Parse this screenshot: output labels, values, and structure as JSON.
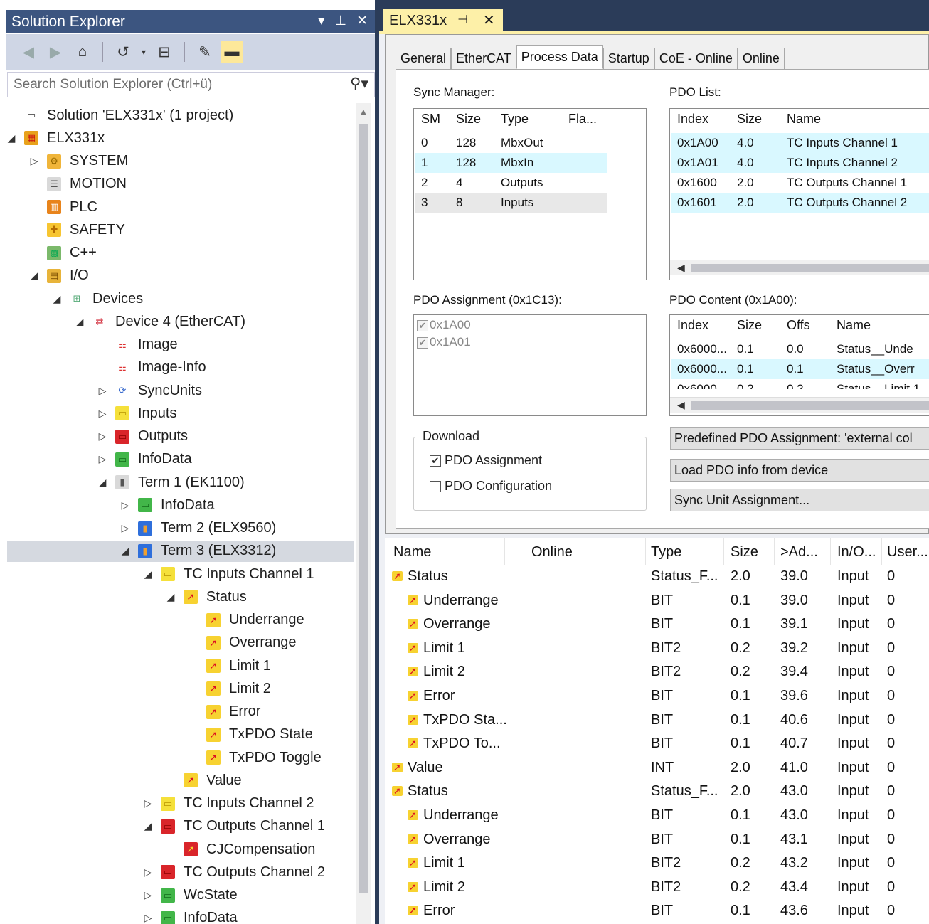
{
  "solution_explorer": {
    "title": "Solution Explorer",
    "title_controls": [
      "▾",
      "⊥",
      "✕"
    ],
    "search_placeholder": "Search Solution Explorer (Ctrl+ü)",
    "tree": [
      {
        "label": "Solution 'ELX331x' (1 project)",
        "indent": 0,
        "expander": "",
        "icon": "solution-icon"
      },
      {
        "label": "ELX331x",
        "indent": 0,
        "expander": "◢",
        "icon": "project-icon"
      },
      {
        "label": "SYSTEM",
        "indent": 1,
        "expander": "▷",
        "icon": "system-icon"
      },
      {
        "label": "MOTION",
        "indent": 1,
        "expander": "",
        "icon": "motion-icon"
      },
      {
        "label": "PLC",
        "indent": 1,
        "expander": "",
        "icon": "plc-icon"
      },
      {
        "label": "SAFETY",
        "indent": 1,
        "expander": "",
        "icon": "safety-icon"
      },
      {
        "label": "C++",
        "indent": 1,
        "expander": "",
        "icon": "cpp-icon"
      },
      {
        "label": "I/O",
        "indent": 1,
        "expander": "◢",
        "icon": "io-icon"
      },
      {
        "label": "Devices",
        "indent": 2,
        "expander": "◢",
        "icon": "devices-icon"
      },
      {
        "label": "Device 4 (EtherCAT)",
        "indent": 3,
        "expander": "◢",
        "icon": "ethercat-device-icon"
      },
      {
        "label": "Image",
        "indent": 4,
        "expander": "",
        "icon": "image-icon"
      },
      {
        "label": "Image-Info",
        "indent": 4,
        "expander": "",
        "icon": "image-info-icon"
      },
      {
        "label": "SyncUnits",
        "indent": 4,
        "expander": "▷",
        "icon": "syncunits-icon"
      },
      {
        "label": "Inputs",
        "indent": 4,
        "expander": "▷",
        "icon": "inputs-icon"
      },
      {
        "label": "Outputs",
        "indent": 4,
        "expander": "▷",
        "icon": "outputs-icon"
      },
      {
        "label": "InfoData",
        "indent": 4,
        "expander": "▷",
        "icon": "infodata-icon"
      },
      {
        "label": "Term 1 (EK1100)",
        "indent": 4,
        "expander": "◢",
        "icon": "terminal-icon"
      },
      {
        "label": "InfoData",
        "indent": 5,
        "expander": "▷",
        "icon": "infodata-icon"
      },
      {
        "label": "Term 2 (ELX9560)",
        "indent": 5,
        "expander": "▷",
        "icon": "terminal-blue-icon"
      },
      {
        "label": "Term 3 (ELX3312)",
        "indent": 5,
        "expander": "◢",
        "icon": "terminal-blue-icon",
        "selected": true
      },
      {
        "label": "TC Inputs Channel 1",
        "indent": 6,
        "expander": "◢",
        "icon": "inputs-icon"
      },
      {
        "label": "Status",
        "indent": 7,
        "expander": "◢",
        "icon": "variable-icon"
      },
      {
        "label": "Underrange",
        "indent": 8,
        "expander": "",
        "icon": "variable-icon"
      },
      {
        "label": "Overrange",
        "indent": 8,
        "expander": "",
        "icon": "variable-icon"
      },
      {
        "label": "Limit 1",
        "indent": 8,
        "expander": "",
        "icon": "variable-icon"
      },
      {
        "label": "Limit 2",
        "indent": 8,
        "expander": "",
        "icon": "variable-icon"
      },
      {
        "label": "Error",
        "indent": 8,
        "expander": "",
        "icon": "variable-icon"
      },
      {
        "label": "TxPDO State",
        "indent": 8,
        "expander": "",
        "icon": "variable-icon"
      },
      {
        "label": "TxPDO Toggle",
        "indent": 8,
        "expander": "",
        "icon": "variable-icon"
      },
      {
        "label": "Value",
        "indent": 7,
        "expander": "",
        "icon": "variable-icon"
      },
      {
        "label": "TC Inputs Channel 2",
        "indent": 6,
        "expander": "▷",
        "icon": "inputs-icon"
      },
      {
        "label": "TC Outputs Channel 1",
        "indent": 6,
        "expander": "◢",
        "icon": "outputs-icon"
      },
      {
        "label": "CJCompensation",
        "indent": 7,
        "expander": "",
        "icon": "output-variable-icon"
      },
      {
        "label": "TC Outputs Channel 2",
        "indent": 6,
        "expander": "▷",
        "icon": "outputs-icon"
      },
      {
        "label": "WcState",
        "indent": 6,
        "expander": "▷",
        "icon": "infodata-icon"
      },
      {
        "label": "InfoData",
        "indent": 6,
        "expander": "▷",
        "icon": "infodata-icon"
      }
    ]
  },
  "document": {
    "tab_title": "ELX331x",
    "tabs": [
      "General",
      "EtherCAT",
      "Process Data",
      "Startup",
      "CoE - Online",
      "Online"
    ],
    "active_tab": "Process Data",
    "sync_manager": {
      "label": "Sync Manager:",
      "columns": [
        "SM",
        "Size",
        "Type",
        "Fla..."
      ],
      "rows": [
        {
          "sm": "0",
          "size": "128",
          "type": "MbxOut"
        },
        {
          "sm": "1",
          "size": "128",
          "type": "MbxIn"
        },
        {
          "sm": "2",
          "size": "4",
          "type": "Outputs"
        },
        {
          "sm": "3",
          "size": "8",
          "type": "Inputs"
        }
      ]
    },
    "pdo_list": {
      "label": "PDO List:",
      "columns": [
        "Index",
        "Size",
        "Name"
      ],
      "rows": [
        {
          "index": "0x1A00",
          "size": "4.0",
          "name": "TC Inputs Channel 1"
        },
        {
          "index": "0x1A01",
          "size": "4.0",
          "name": "TC Inputs Channel 2"
        },
        {
          "index": "0x1600",
          "size": "2.0",
          "name": "TC Outputs Channel 1"
        },
        {
          "index": "0x1601",
          "size": "2.0",
          "name": "TC Outputs Channel 2"
        }
      ]
    },
    "pdo_assignment": {
      "label": "PDO Assignment (0x1C13):",
      "items": [
        {
          "label": "0x1A00",
          "checked": true
        },
        {
          "label": "0x1A01",
          "checked": true
        }
      ]
    },
    "pdo_content": {
      "label": "PDO Content (0x1A00):",
      "columns": [
        "Index",
        "Size",
        "Offs",
        "Name"
      ],
      "rows": [
        {
          "index": "0x6000...",
          "size": "0.1",
          "offs": "0.0",
          "name": "Status__Unde"
        },
        {
          "index": "0x6000...",
          "size": "0.1",
          "offs": "0.1",
          "name": "Status__Overr"
        },
        {
          "index": "0x6000",
          "size": "0.2",
          "offs": "0.2",
          "name": "Status__Limit 1"
        }
      ]
    },
    "download": {
      "label": "Download",
      "pdo_assignment": {
        "label": "PDO Assignment",
        "checked": true
      },
      "pdo_configuration": {
        "label": "PDO Configuration",
        "checked": false
      }
    },
    "buttons": {
      "predefined": "Predefined PDO Assignment: 'external col",
      "load_pdo": "Load PDO info from device",
      "sync_unit": "Sync Unit Assignment..."
    }
  },
  "variables_grid": {
    "columns": [
      "Name",
      "Online",
      "Type",
      "Size",
      ">Ad...",
      "In/O...",
      "User..."
    ],
    "rows": [
      {
        "name": "Status",
        "level": 0,
        "type": "Status_F...",
        "size": "2.0",
        "addr": "39.0",
        "io": "Input",
        "user": "0"
      },
      {
        "name": "Underrange",
        "level": 1,
        "type": "BIT",
        "size": "0.1",
        "addr": "39.0",
        "io": "Input",
        "user": "0"
      },
      {
        "name": "Overrange",
        "level": 1,
        "type": "BIT",
        "size": "0.1",
        "addr": "39.1",
        "io": "Input",
        "user": "0"
      },
      {
        "name": "Limit 1",
        "level": 1,
        "type": "BIT2",
        "size": "0.2",
        "addr": "39.2",
        "io": "Input",
        "user": "0"
      },
      {
        "name": "Limit 2",
        "level": 1,
        "type": "BIT2",
        "size": "0.2",
        "addr": "39.4",
        "io": "Input",
        "user": "0"
      },
      {
        "name": "Error",
        "level": 1,
        "type": "BIT",
        "size": "0.1",
        "addr": "39.6",
        "io": "Input",
        "user": "0"
      },
      {
        "name": "TxPDO Sta...",
        "level": 1,
        "type": "BIT",
        "size": "0.1",
        "addr": "40.6",
        "io": "Input",
        "user": "0"
      },
      {
        "name": "TxPDO To...",
        "level": 1,
        "type": "BIT",
        "size": "0.1",
        "addr": "40.7",
        "io": "Input",
        "user": "0"
      },
      {
        "name": "Value",
        "level": 0,
        "type": "INT",
        "size": "2.0",
        "addr": "41.0",
        "io": "Input",
        "user": "0"
      },
      {
        "name": "Status",
        "level": 0,
        "type": "Status_F...",
        "size": "2.0",
        "addr": "43.0",
        "io": "Input",
        "user": "0"
      },
      {
        "name": "Underrange",
        "level": 1,
        "type": "BIT",
        "size": "0.1",
        "addr": "43.0",
        "io": "Input",
        "user": "0"
      },
      {
        "name": "Overrange",
        "level": 1,
        "type": "BIT",
        "size": "0.1",
        "addr": "43.1",
        "io": "Input",
        "user": "0"
      },
      {
        "name": "Limit 1",
        "level": 1,
        "type": "BIT2",
        "size": "0.2",
        "addr": "43.2",
        "io": "Input",
        "user": "0"
      },
      {
        "name": "Limit 2",
        "level": 1,
        "type": "BIT2",
        "size": "0.2",
        "addr": "43.4",
        "io": "Input",
        "user": "0"
      },
      {
        "name": "Error",
        "level": 1,
        "type": "BIT",
        "size": "0.1",
        "addr": "43.6",
        "io": "Input",
        "user": "0"
      }
    ]
  }
}
